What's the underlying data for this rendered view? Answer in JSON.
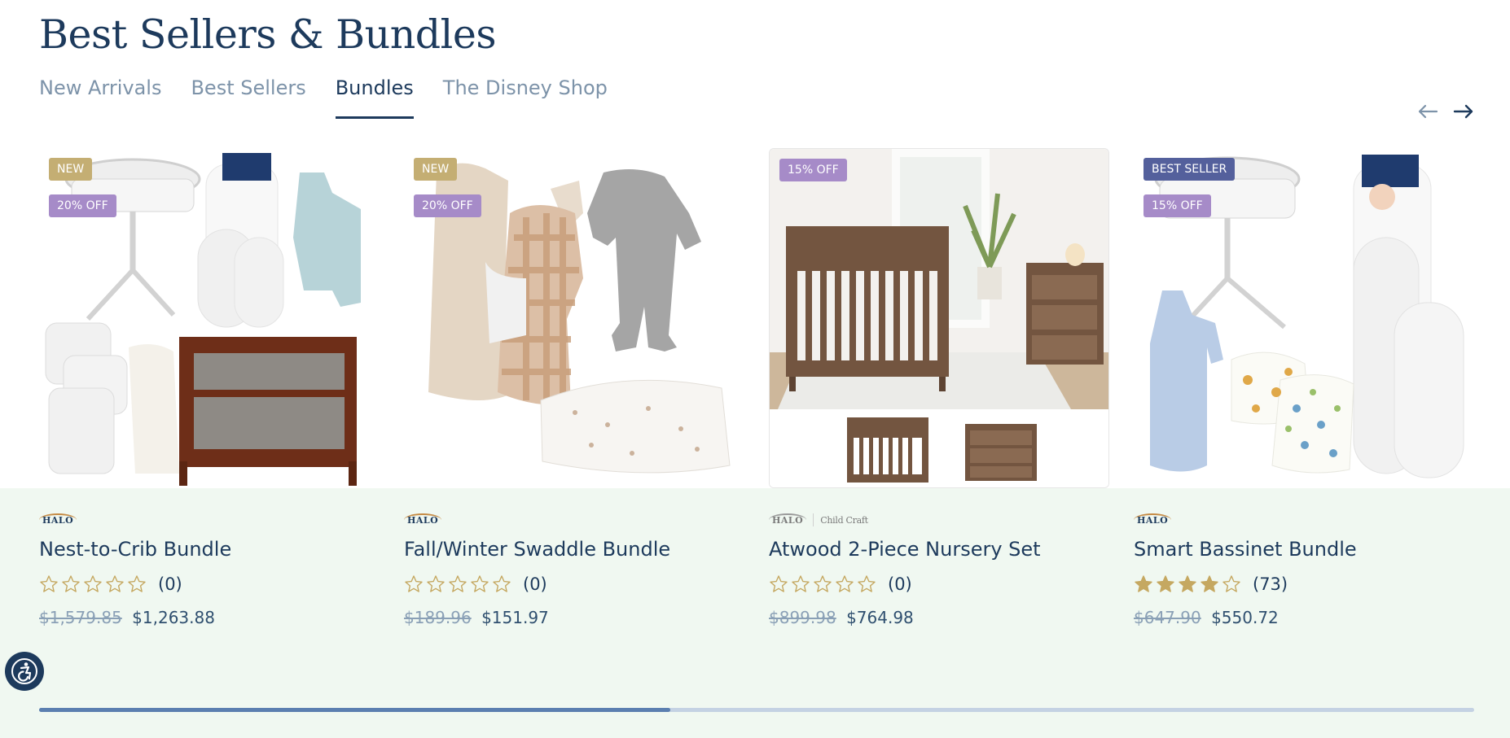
{
  "section": {
    "title": "Best Sellers & Bundles"
  },
  "tabs": [
    {
      "label": "New Arrivals",
      "active": false
    },
    {
      "label": "Best Sellers",
      "active": false
    },
    {
      "label": "Bundles",
      "active": true
    },
    {
      "label": "The Disney Shop",
      "active": false
    }
  ],
  "carousel": {
    "prev_icon": "arrow-left-icon",
    "next_icon": "arrow-right-icon",
    "progress": 0.44
  },
  "products": [
    {
      "badges": [
        "NEW",
        "20% OFF"
      ],
      "brands": [
        "HALO"
      ],
      "name": "Nest-to-Crib Bundle",
      "rating": 0,
      "rating_count": "(0)",
      "price_old": "$1,579.85",
      "price_new": "$1,263.88"
    },
    {
      "badges": [
        "NEW",
        "20% OFF"
      ],
      "brands": [
        "HALO"
      ],
      "name": "Fall/Winter Swaddle Bundle",
      "rating": 0,
      "rating_count": "(0)",
      "price_old": "$189.96",
      "price_new": "$151.97"
    },
    {
      "badges": [
        "15% OFF"
      ],
      "brands": [
        "HALO",
        "Child Craft"
      ],
      "name": "Atwood 2-Piece Nursery Set",
      "rating": 0,
      "rating_count": "(0)",
      "price_old": "$899.98",
      "price_new": "$764.98"
    },
    {
      "badges": [
        "BEST SELLER",
        "15% OFF"
      ],
      "brands": [
        "HALO"
      ],
      "name": "Smart Bassinet Bundle",
      "rating": 4,
      "rating_count": "(73)",
      "price_old": "$647.90",
      "price_new": "$550.72"
    }
  ],
  "accessibility": {
    "icon": "accessibility-icon"
  },
  "colors": {
    "navy": "#1d3a5c",
    "gold": "#c4ae73",
    "lavender": "#a68bc8",
    "indigo": "#54609c",
    "mint": "#f0f8f1",
    "star": "#c5a861"
  }
}
